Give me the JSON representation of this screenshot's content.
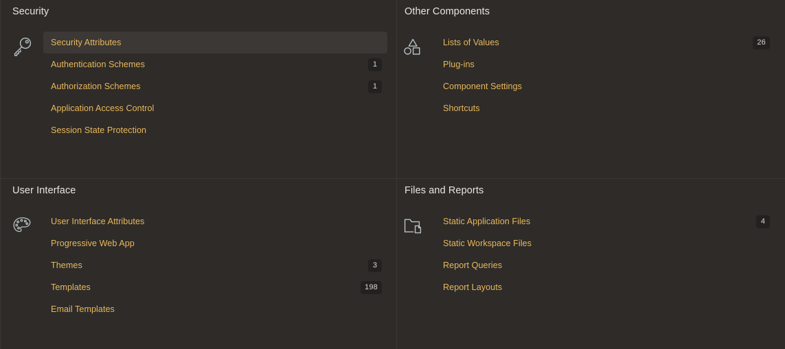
{
  "theme": {
    "background": "#2e2b28",
    "divider": "#3a3734",
    "link_color": "#e8b85c",
    "heading_color": "#e8e6e3",
    "selected_row_bg": "#3b3835",
    "badge_bg": "#232120",
    "badge_text": "#d8d5d1",
    "icon_stroke": "#b9c3c6"
  },
  "panels": [
    {
      "title": "Security",
      "icon": "key-icon",
      "items": [
        {
          "label": "Security Attributes",
          "badge": "",
          "selected": true
        },
        {
          "label": "Authentication Schemes",
          "badge": "1",
          "selected": false
        },
        {
          "label": "Authorization Schemes",
          "badge": "1",
          "selected": false
        },
        {
          "label": "Application Access Control",
          "badge": "",
          "selected": false
        },
        {
          "label": "Session State Protection",
          "badge": "",
          "selected": false
        }
      ]
    },
    {
      "title": "Other Components",
      "icon": "shapes-icon",
      "items": [
        {
          "label": "Lists of Values",
          "badge": "26",
          "selected": false
        },
        {
          "label": "Plug-ins",
          "badge": "",
          "selected": false
        },
        {
          "label": "Component Settings",
          "badge": "",
          "selected": false
        },
        {
          "label": "Shortcuts",
          "badge": "",
          "selected": false
        }
      ]
    },
    {
      "title": "User Interface",
      "icon": "palette-icon",
      "items": [
        {
          "label": "User Interface Attributes",
          "badge": "",
          "selected": false
        },
        {
          "label": "Progressive Web App",
          "badge": "",
          "selected": false
        },
        {
          "label": "Themes",
          "badge": "3",
          "selected": false
        },
        {
          "label": "Templates",
          "badge": "198",
          "selected": false
        },
        {
          "label": "Email Templates",
          "badge": "",
          "selected": false
        }
      ]
    },
    {
      "title": "Files and Reports",
      "icon": "folder-file-icon",
      "items": [
        {
          "label": "Static Application Files",
          "badge": "4",
          "selected": false
        },
        {
          "label": "Static Workspace Files",
          "badge": "",
          "selected": false
        },
        {
          "label": "Report Queries",
          "badge": "",
          "selected": false
        },
        {
          "label": "Report Layouts",
          "badge": "",
          "selected": false
        }
      ]
    }
  ]
}
